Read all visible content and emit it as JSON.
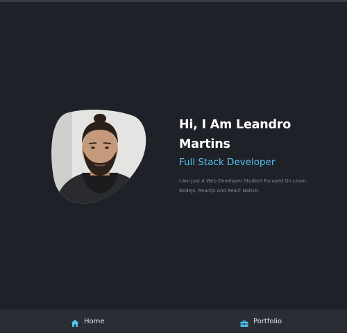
{
  "hero": {
    "name": "Hi, I Am Leandro Martins",
    "role": "Full Stack Developer",
    "description": "I Am Just A Web Developer Student Focused On Learn NodeJs, ReactJs And React Native."
  },
  "nav": {
    "items": [
      {
        "label": "Home",
        "icon": "home-icon"
      },
      {
        "label": "Portfolio",
        "icon": "briefcase-icon"
      }
    ]
  },
  "colors": {
    "background": "#1f2128",
    "accent": "#52c4f0",
    "nav_background": "#2b2d35"
  }
}
